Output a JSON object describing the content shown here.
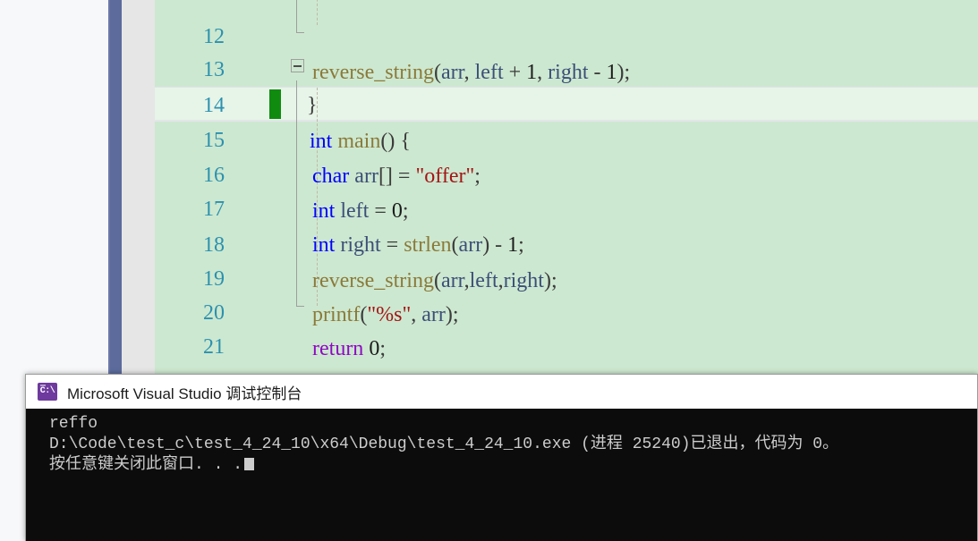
{
  "editor": {
    "background_color": "#cde8d0",
    "accent_bar_color": "#5c6b9c",
    "gutter_color": "#e6e6e6",
    "line_number_color": "#2b91af",
    "current_line_number": "15",
    "change_marker_color": "#108b10",
    "lines": [
      {
        "num": "12",
        "text": "reverse_string(arr, left + 1, right - 1);",
        "partial_top": true
      },
      {
        "num": "13",
        "text": "}"
      },
      {
        "num": "14",
        "text": "int main() {"
      },
      {
        "num": "15",
        "text": "char arr[] = \"offer\";",
        "current": true
      },
      {
        "num": "16",
        "text": "int left = 0;"
      },
      {
        "num": "17",
        "text": "int right = strlen(arr) - 1;"
      },
      {
        "num": "18",
        "text": "reverse_string(arr, left, right);"
      },
      {
        "num": "19",
        "text": "printf(\"%s\", arr);"
      },
      {
        "num": "20",
        "text": "return 0;"
      },
      {
        "num": "21",
        "text": "}"
      }
    ]
  },
  "console": {
    "title": "Microsoft Visual Studio 调试控制台",
    "icon_label": "C:\\",
    "background_color": "#0c0c0c",
    "text_color": "#cccccc",
    "output_lines": [
      "reffo",
      "D:\\Code\\test_c\\test_4_24_10\\x64\\Debug\\test_4_24_10.exe (进程 25240)已退出，代码为 0。",
      "按任意键关闭此窗口. . ."
    ]
  }
}
